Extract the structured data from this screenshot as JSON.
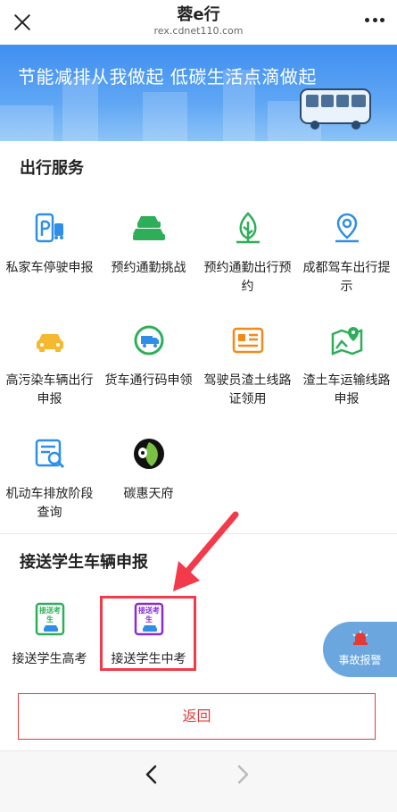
{
  "header": {
    "title": "蓉e行",
    "subtitle": "rex.cdnet110.com"
  },
  "banner": {
    "text": "节能减排从我做起 低碳生活点滴做起"
  },
  "travel_services": {
    "title": "出行服务",
    "items": [
      {
        "label": "私家车停驶申报",
        "icon": "car-parking-icon"
      },
      {
        "label": "预约通勤挑战",
        "icon": "cars-challenge-icon"
      },
      {
        "label": "预约通勤出行预约",
        "icon": "leaf-icon"
      },
      {
        "label": "成都驾车出行提示",
        "icon": "location-pin-icon"
      },
      {
        "label": "高污染车辆出行申报",
        "icon": "car-icon"
      },
      {
        "label": "货车通行码申领",
        "icon": "truck-badge-icon"
      },
      {
        "label": "驾驶员渣土线路证领用",
        "icon": "license-card-icon"
      },
      {
        "label": "渣土车运输线路申报",
        "icon": "route-map-icon"
      },
      {
        "label": "机动车排放阶段查询",
        "icon": "document-search-icon"
      },
      {
        "label": "碳惠天府",
        "icon": "panda-leaf-logo"
      }
    ]
  },
  "student_transport": {
    "title": "接送学生车辆申报",
    "items": [
      {
        "label": "接送学生高考",
        "badge": "接送考生",
        "color": "#2fae5a"
      },
      {
        "label": "接送学生中考",
        "badge": "接送考生",
        "color": "#8a2bd6"
      }
    ]
  },
  "accident_report": {
    "label": "事故报警"
  },
  "back_button": {
    "label": "返回"
  },
  "colors": {
    "accent_blue": "#2f8fe6",
    "orange": "#f28a1a",
    "green": "#2fae5a",
    "red": "#e03a3a",
    "purple": "#8a2bd6"
  }
}
